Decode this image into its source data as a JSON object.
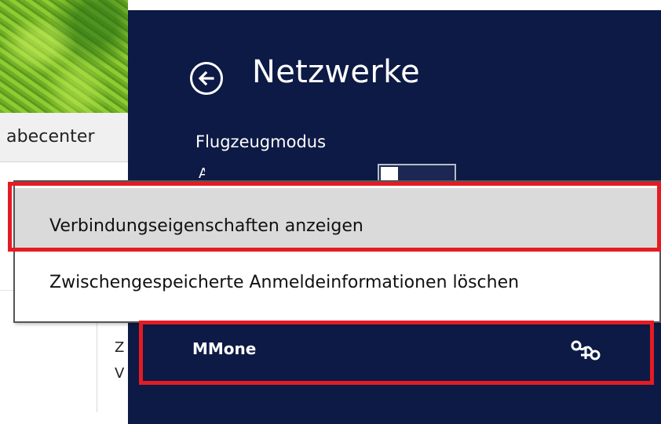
{
  "background_window": {
    "tab_label": "abecenter",
    "row_letters": [
      "Z",
      "V"
    ]
  },
  "charm": {
    "title": "Netzwerke",
    "airplane_mode_label": "Flugzeugmodus",
    "airplane_mode_state": "A",
    "network": {
      "name": "MMone",
      "icon": "network-connection-icon"
    }
  },
  "context_menu": {
    "items": [
      {
        "label": "Verbindungseigenschaften anzeigen"
      },
      {
        "label": "Zwischengespeicherte Anmeldeinformationen löschen"
      }
    ]
  },
  "colors": {
    "charm_background": "#0d1a45",
    "highlight": "#e51b23",
    "menu_hover": "#dadada"
  }
}
